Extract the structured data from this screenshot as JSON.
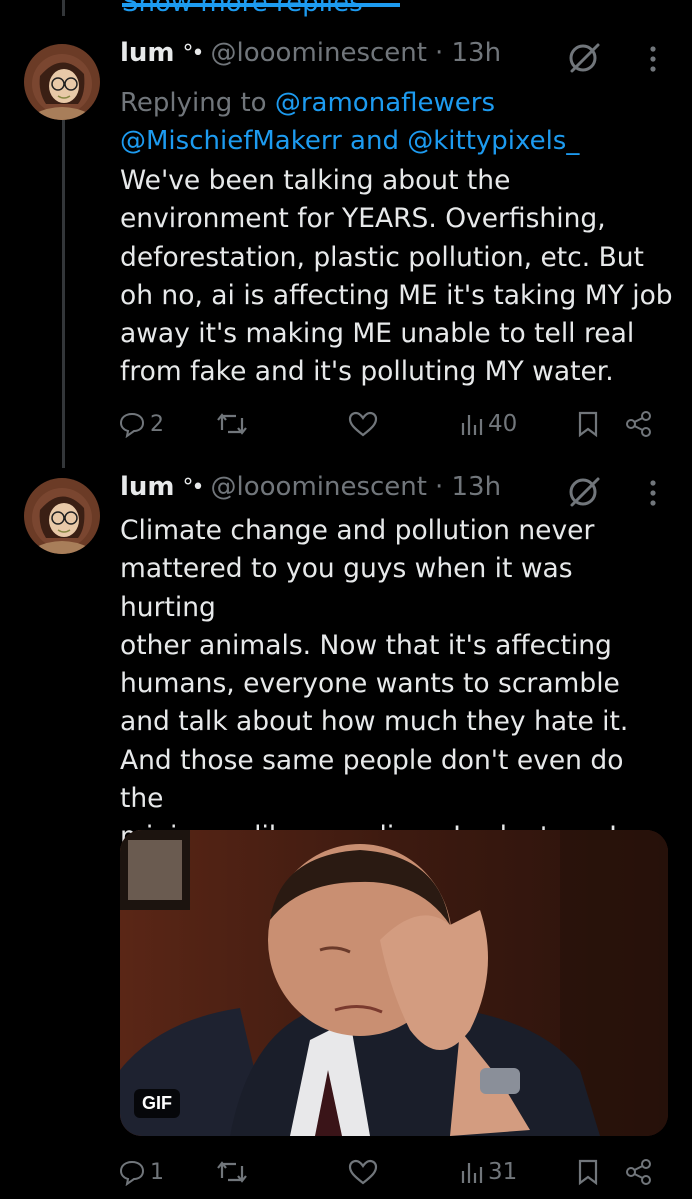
{
  "thread": {
    "show_more_label": "Show more replies"
  },
  "posts": [
    {
      "name": "lum",
      "badge": "°•",
      "handle": "@looominescent",
      "time": "· 13h",
      "replying_prefix": "Replying to",
      "replying_to_1": "@ramonaflewers",
      "replying_to_2": "@MischiefMakerr",
      "replying_and": "and",
      "replying_to_3": "@kittypixels_",
      "text": "We've been talking about the\nenvironment for YEARS. Overfishing,\ndeforestation, plastic pollution, etc. But\noh no, ai is affecting ME it's taking MY job\naway it's making ME unable to tell real\nfrom fake and it's polluting MY water.",
      "replies": "2",
      "reposts": "",
      "likes": "",
      "views": "40"
    },
    {
      "name": "lum",
      "badge": "°•",
      "handle": "@looominescent",
      "time": "· 13h",
      "text": "Climate change and pollution never\nmattered to you guys when it was hurting\nother animals. Now that it's affecting\nhumans, everyone wants to scramble\nand talk about how much they hate it.\nAnd those same people don't even do the\nminimum like recycling.  Look at me I\ndon't use ai!!",
      "media_badge": "GIF",
      "replies": "1",
      "reposts": "",
      "likes": "",
      "views": "31"
    }
  ],
  "icons": [
    "reply-icon",
    "repost-icon",
    "like-icon",
    "views-icon",
    "bookmark-icon",
    "share-icon",
    "grok-icon",
    "more-icon"
  ],
  "colors": {
    "background": "#000000",
    "text": "#e7e9ea",
    "muted": "#71767b",
    "accent": "#1d9bf0"
  }
}
